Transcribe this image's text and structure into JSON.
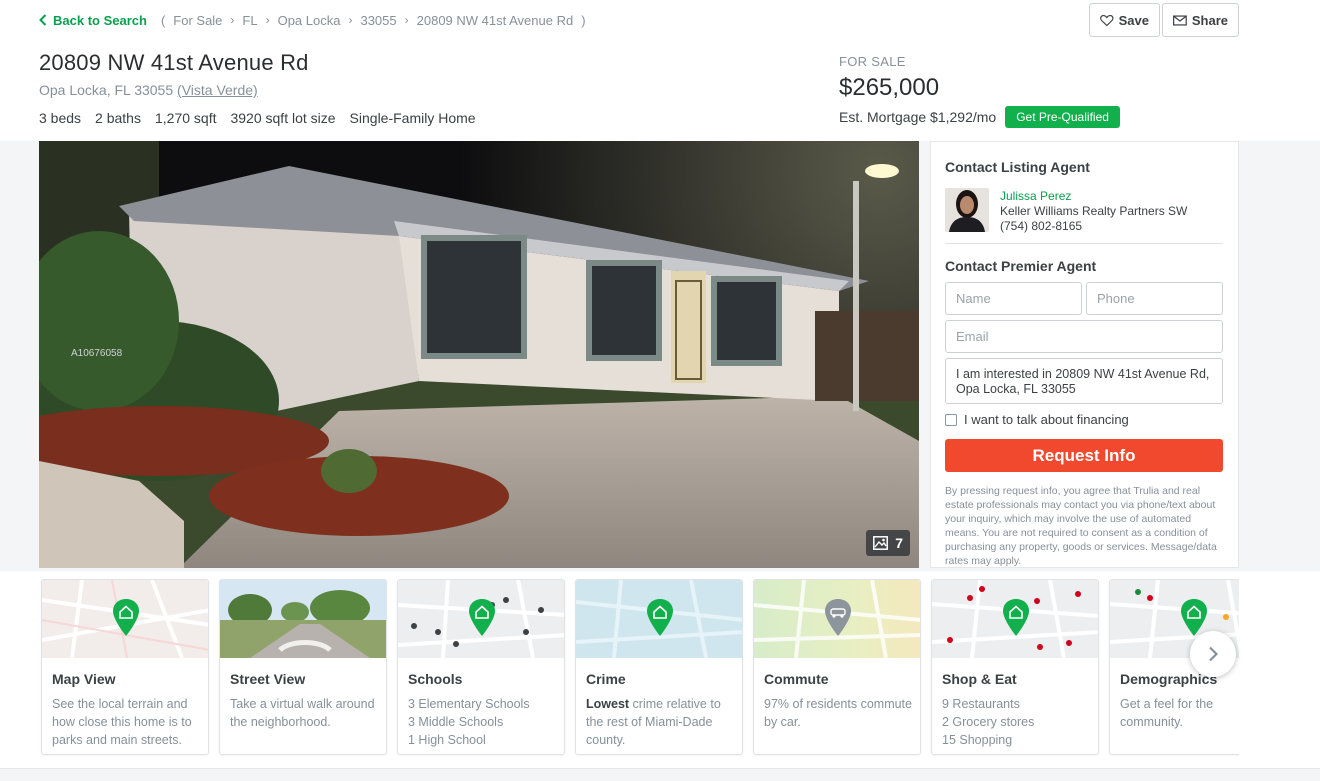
{
  "topbar": {
    "back_label": "Back to Search",
    "crumb_open": "(",
    "crumb_close": ")",
    "breadcrumbs": [
      "For Sale",
      "FL",
      "Opa Locka",
      "33055",
      "20809 NW 41st Avenue Rd"
    ],
    "save_label": "Save",
    "share_label": "Share"
  },
  "listing": {
    "address": "20809 NW 41st Avenue Rd",
    "city_line": "Opa Locka, FL 33055",
    "neighborhood": "(Vista Verde)",
    "beds": "3 beds",
    "baths": "2 baths",
    "sqft": "1,270 sqft",
    "lot": "3920 sqft lot size",
    "type": "Single-Family Home",
    "status": "FOR SALE",
    "price": "$265,000",
    "mortgage": "Est. Mortgage $1,292/mo",
    "prequal_label": "Get Pre-Qualified"
  },
  "photo": {
    "watermark": "A10676058",
    "photo_count": "7"
  },
  "contact": {
    "listing_heading": "Contact Listing Agent",
    "agent_name": "Julissa Perez",
    "agent_company": "Keller Williams Realty Partners SW",
    "agent_phone": "(754) 802-8165",
    "premier_heading": "Contact Premier Agent",
    "name_placeholder": "Name",
    "phone_placeholder": "Phone",
    "email_placeholder": "Email",
    "message": "I am interested in 20809 NW 41st Avenue Rd, Opa Locka, FL 33055",
    "financing_label": "I want to talk about financing",
    "request_label": "Request Info",
    "legal": "By pressing request info, you agree that Trulia and real estate professionals may contact you via phone/text about your inquiry, which may involve the use of automated means. You are not required to consent as a condition of purchasing any property, goods or services. Message/data rates may apply."
  },
  "cards": [
    {
      "title": "Map View",
      "desc": "See the local terrain and how close this home is to parks and main streets."
    },
    {
      "title": "Street View",
      "desc": "Take a virtual walk around the neighborhood."
    },
    {
      "title": "Schools",
      "lines": [
        "3 Elementary Schools",
        "3 Middle Schools",
        "1 High School"
      ]
    },
    {
      "title": "Crime",
      "bold": "Lowest",
      "desc": "crime relative to the rest of Miami-Dade county."
    },
    {
      "title": "Commute",
      "desc": "97% of residents commute by car."
    },
    {
      "title": "Shop & Eat",
      "lines": [
        "9 Restaurants",
        "2 Grocery stores",
        "15 Shopping"
      ]
    },
    {
      "title": "Demographics",
      "desc": "Get a feel for the community."
    }
  ],
  "colors": {
    "brand_green": "#0aa04f",
    "request_orange": "#f0492d",
    "pin_green": "#12b04c"
  }
}
